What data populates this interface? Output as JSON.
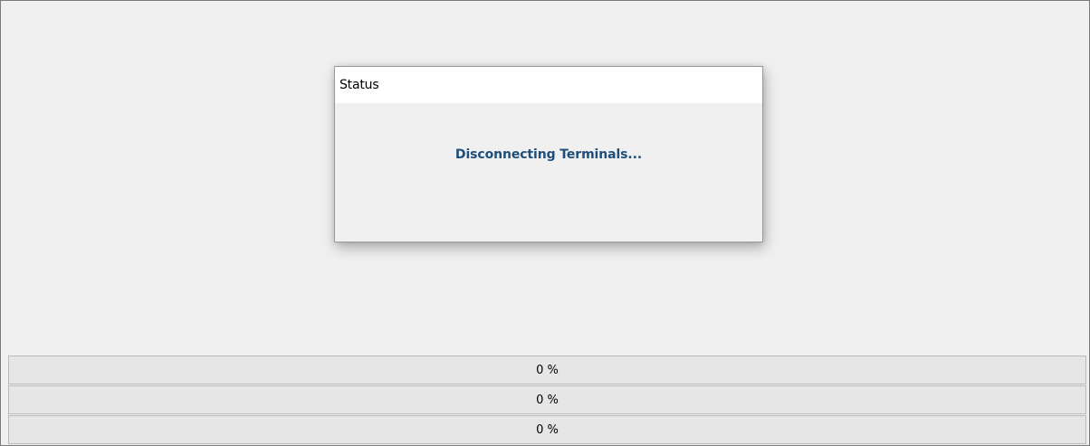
{
  "dialog": {
    "title": "Status",
    "message": "Disconnecting Terminals...",
    "message_color": "#1e4e79"
  },
  "progress_bars": [
    {
      "label": "0 %",
      "value": 0
    },
    {
      "label": "0 %",
      "value": 0
    },
    {
      "label": "0 %",
      "value": 0
    }
  ]
}
